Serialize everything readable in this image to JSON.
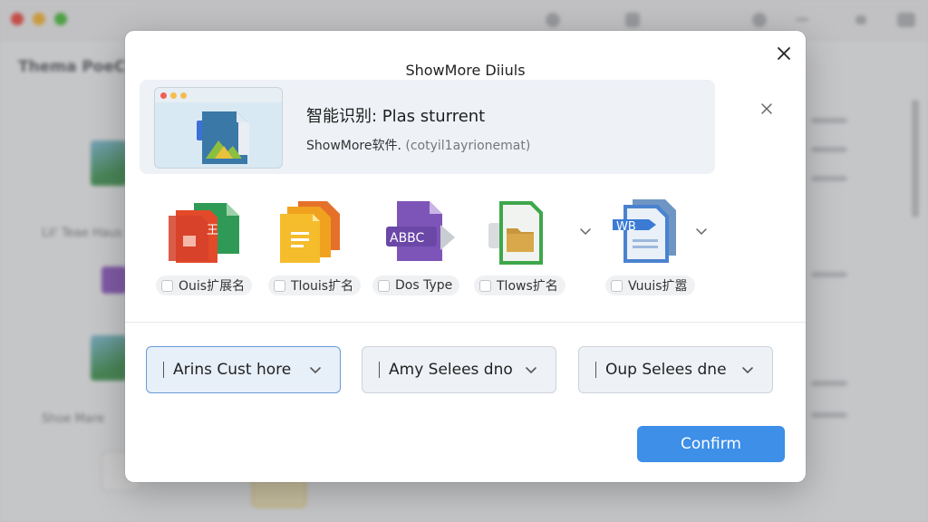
{
  "background": {
    "page_title": "Thema PoeC",
    "section_label": "Lil' Teae Haus",
    "section_label_2": "Shoe Mare"
  },
  "dialog": {
    "title": "ShowMore Diiuls",
    "close_icon": "close-icon"
  },
  "file_info": {
    "title": "智能识别: Plas sturrent",
    "subtitle_prefix": "ShowMore软件.",
    "subtitle_detail": "(cotyil1ayrionemat)"
  },
  "formats": [
    {
      "label": "Ouis扩展名",
      "icon": "ppt-document-icon"
    },
    {
      "label": "Tlouis扩名",
      "icon": "text-document-icon"
    },
    {
      "label": "Dos Type",
      "icon": "abbc-document-icon",
      "badge": "ABBC"
    },
    {
      "label": "Tlows扩名",
      "icon": "folder-document-icon"
    },
    {
      "label": "Vuuis扩嚣",
      "icon": "word-document-icon",
      "badge": "WB"
    }
  ],
  "selects": [
    {
      "value": "Arins Cust hore"
    },
    {
      "value": "Amy Selees dno"
    },
    {
      "value": "Oup Selees dne"
    }
  ],
  "confirm_label": "Confirm",
  "colors": {
    "accent": "#3d8fe8",
    "banner_bg": "#eef2f7",
    "active_select_border": "#6a9bd8"
  }
}
